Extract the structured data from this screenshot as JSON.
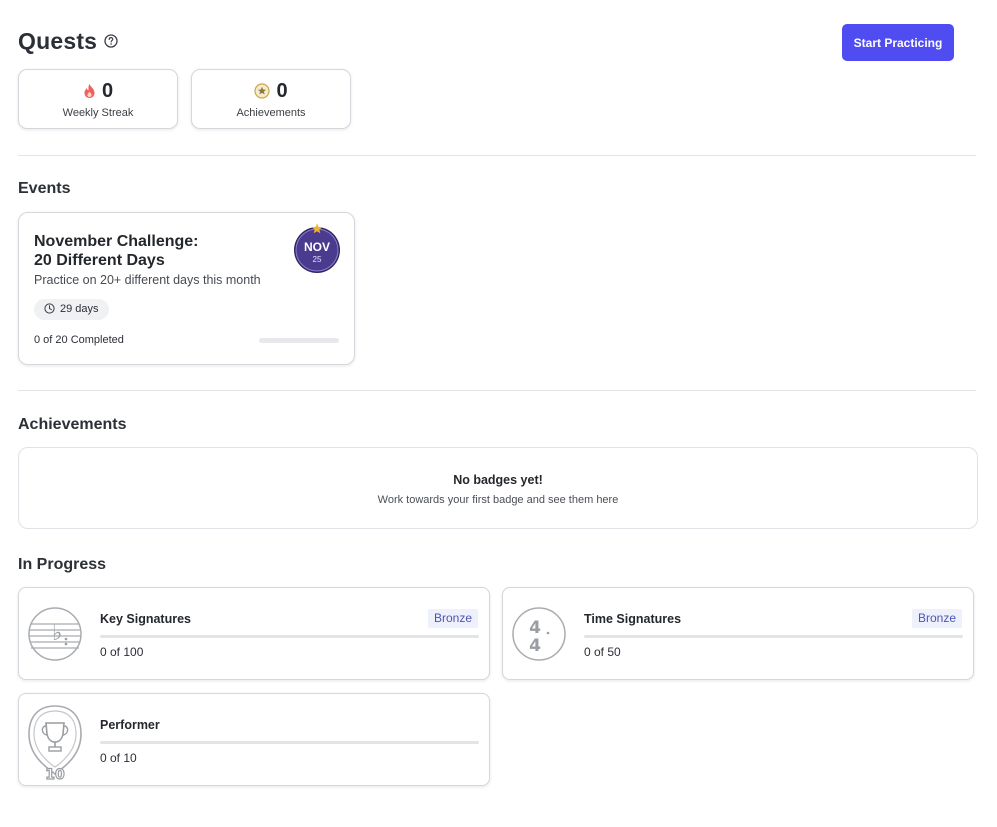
{
  "header": {
    "title": "Quests",
    "start_button": "Start Practicing"
  },
  "stats": [
    {
      "value": "0",
      "label": "Weekly Streak",
      "icon": "flame-icon"
    },
    {
      "value": "0",
      "label": "Achievements",
      "icon": "star-medal-icon"
    }
  ],
  "events": {
    "title": "Events",
    "card": {
      "title_line1": "November Challenge:",
      "title_line2": "20 Different Days",
      "description": "Practice on 20+ different days this month",
      "days_left": "29 days",
      "progress_text": "0 of 20 Completed",
      "progress_fraction": 0,
      "badge_month": "NOV",
      "badge_year": "25"
    }
  },
  "achievements": {
    "title": "Achievements",
    "empty_title": "No badges yet!",
    "empty_subtitle": "Work towards your first badge and see them here"
  },
  "in_progress": {
    "title": "In Progress",
    "items": [
      {
        "name": "Key Signatures",
        "tier": "Bronze",
        "count": "0 of 100",
        "progress_fraction": 0,
        "icon": "key-signature-icon"
      },
      {
        "name": "Time Signatures",
        "tier": "Bronze",
        "count": "0 of 50",
        "progress_fraction": 0,
        "icon": "time-signature-icon"
      },
      {
        "name": "Performer",
        "count": "0 of 10",
        "progress_fraction": 0,
        "icon": "trophy-icon",
        "icon_number": "10"
      }
    ]
  },
  "colors": {
    "accent": "#4f4cf2",
    "flame": "#f0605c",
    "badge_purple": "#4b3b8f",
    "tier_text": "#4b56b5"
  }
}
